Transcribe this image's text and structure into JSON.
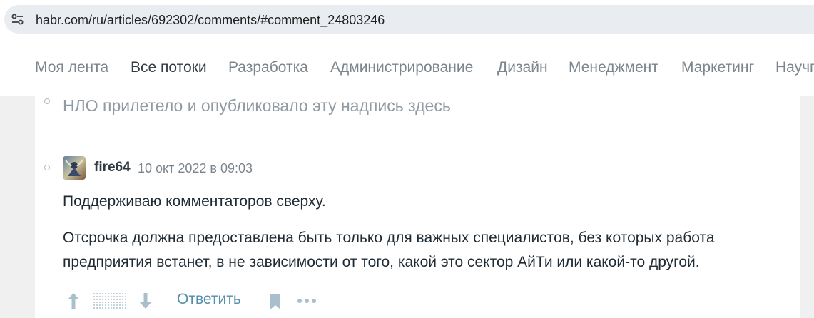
{
  "browser": {
    "url": "habr.com/ru/articles/692302/comments/#comment_24803246",
    "site_info_icon": "tune-icon"
  },
  "nav": {
    "items": [
      {
        "label": "Моя лента",
        "active": false
      },
      {
        "label": "Все потоки",
        "active": true
      },
      {
        "label": "Разработка",
        "active": false
      },
      {
        "label": "Администрирование",
        "active": false
      },
      {
        "label": "Дизайн",
        "active": false
      },
      {
        "label": "Менеджмент",
        "active": false
      },
      {
        "label": "Маркетинг",
        "active": false
      },
      {
        "label": "Научпоп",
        "active": false
      }
    ]
  },
  "thread": {
    "deleted_comment_text": "НЛО прилетело и опубликовало эту надпись здесь",
    "comment": {
      "author": "fire64",
      "timestamp": "10 окт 2022 в 09:03",
      "paragraphs": [
        "Поддерживаю комментаторов сверху.",
        "Отсрочка должна предоставлена быть только для важных специалистов, без которых работа предприятия встанет, в не зависимости от того, какой это сектор АйТи или какой-то другой."
      ],
      "actions": {
        "upvote_icon": "arrow-up-icon",
        "score_icon": "score-placeholder-icon",
        "downvote_icon": "arrow-down-icon",
        "reply_label": "Ответить",
        "bookmark_icon": "bookmark-icon",
        "more_icon": "more-dots-icon"
      }
    }
  },
  "colors": {
    "nav_text": "#7b858e",
    "nav_active": "#303b44",
    "link": "#548eaa",
    "icon": "#a9bfcc"
  }
}
